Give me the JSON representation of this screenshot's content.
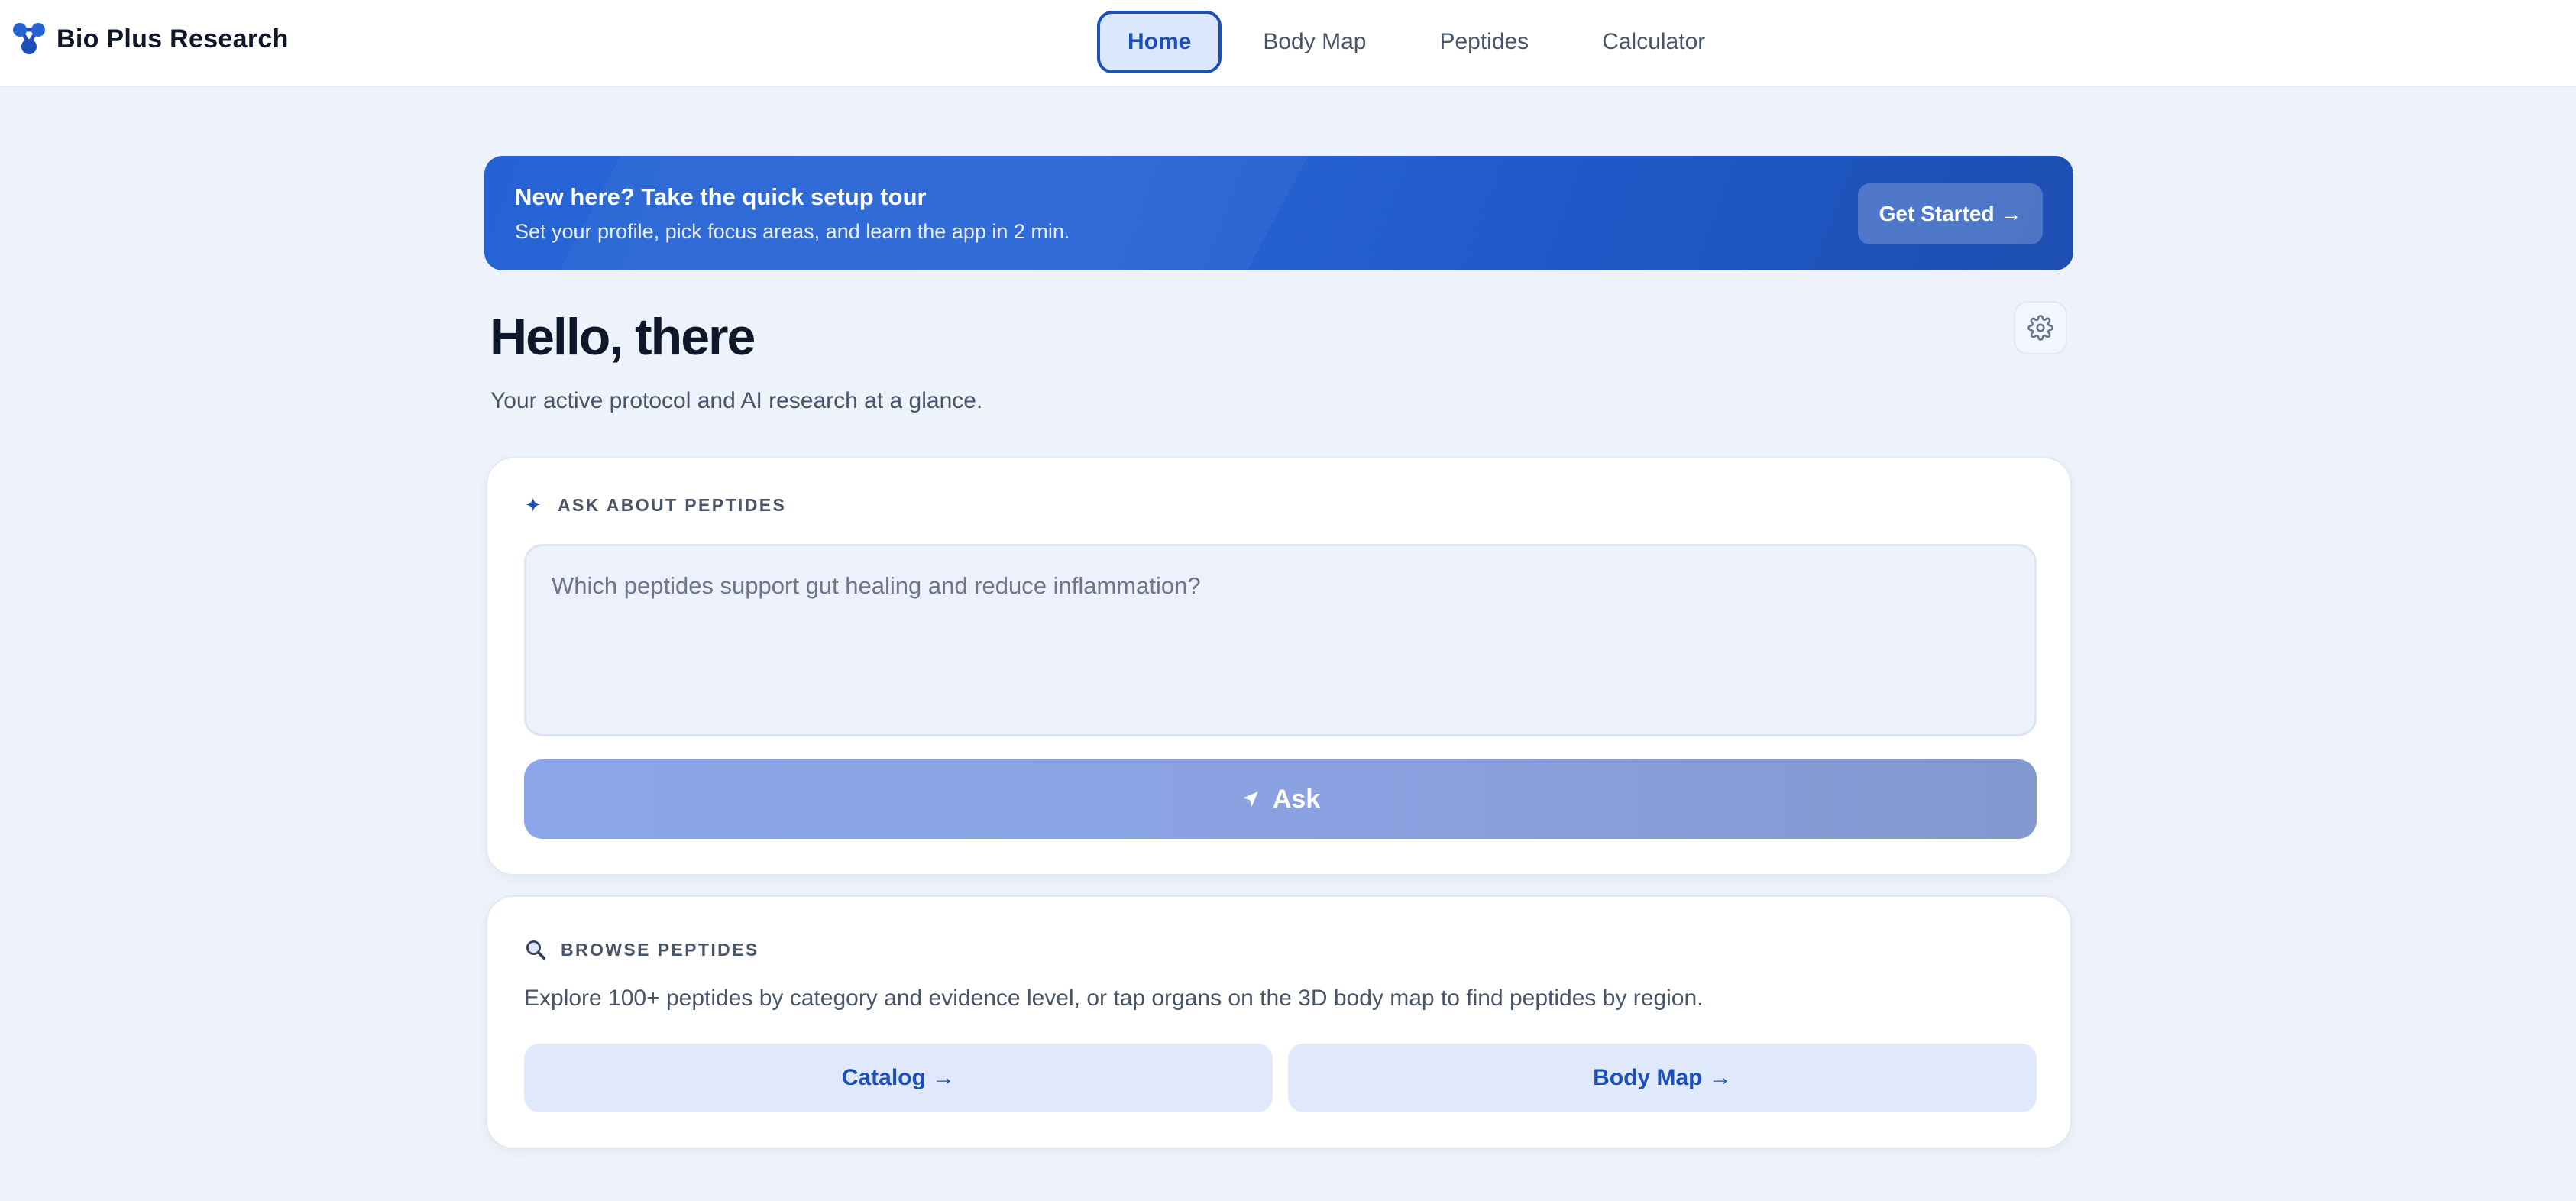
{
  "app": {
    "name": "Bio Plus Research",
    "logo_icon": "molecule-logo-icon",
    "accent": "#1d4fb8"
  },
  "nav": {
    "items": [
      {
        "label": "Home",
        "active": true
      },
      {
        "label": "Body Map",
        "active": false
      },
      {
        "label": "Peptides",
        "active": false
      },
      {
        "label": "Calculator",
        "active": false
      }
    ]
  },
  "banner": {
    "title": "New here? Take the quick setup tour",
    "subtitle": "Set your profile, pick focus areas, and learn the app in 2 min.",
    "button_label": "Get Started →"
  },
  "greeting": {
    "title": "Hello, there",
    "subtitle": "Your active protocol and AI research at a glance.",
    "settings_icon": "gear-icon"
  },
  "ask": {
    "heading": "ASK ABOUT PEPTIDES",
    "heading_icon": "sparkle-icon",
    "placeholder": "Which peptides support gut healing and reduce inflammation?",
    "button_label": "Ask",
    "button_icon": "send-icon"
  },
  "browse": {
    "heading": "BROWSE PEPTIDES",
    "heading_icon": "magnifier-icon",
    "description": "Explore 100+ peptides by category and evidence level, or tap organs on the 3D body map to find peptides by region.",
    "catalog_label": "Catalog →",
    "bodymap_label": "Body Map →"
  }
}
